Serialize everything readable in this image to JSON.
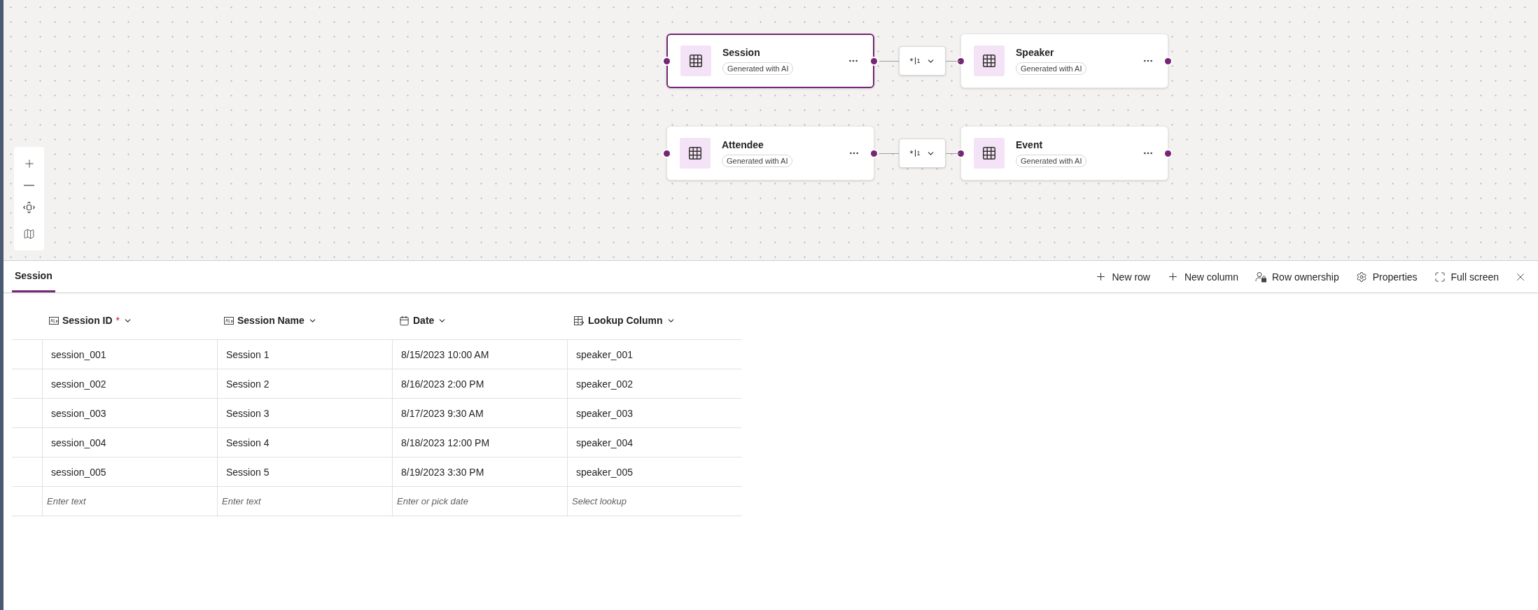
{
  "diagram_rows": [
    {
      "entities": [
        {
          "name": "Session",
          "badge": "Generated with AI",
          "selected": true
        },
        {
          "name": "Speaker",
          "badge": "Generated with AI",
          "selected": false
        }
      ],
      "relationship": {
        "many": "*",
        "one": "1"
      }
    },
    {
      "entities": [
        {
          "name": "Attendee",
          "badge": "Generated with AI",
          "selected": false
        },
        {
          "name": "Event",
          "badge": "Generated with AI",
          "selected": false
        }
      ],
      "relationship": {
        "many": "*",
        "one": "1"
      }
    }
  ],
  "tabs": [
    {
      "label": "Session",
      "selected": true
    }
  ],
  "toolbar": [
    {
      "kind": "add",
      "label": "New row"
    },
    {
      "kind": "add",
      "label": "New column"
    },
    {
      "kind": "ownership",
      "label": "Row ownership"
    },
    {
      "kind": "settings",
      "label": "Properties"
    },
    {
      "kind": "fullscreen",
      "label": "Full screen"
    }
  ],
  "table": {
    "columns": [
      {
        "kind": "text",
        "label": "Session ID",
        "required_mark": "*"
      },
      {
        "kind": "text",
        "label": "Session Name"
      },
      {
        "kind": "date",
        "label": "Date"
      },
      {
        "kind": "lookup",
        "label": "Lookup Column"
      }
    ],
    "rows": [
      [
        "session_001",
        "Session 1",
        "8/15/2023 10:00 AM",
        "speaker_001"
      ],
      [
        "session_002",
        "Session 2",
        "8/16/2023 2:00 PM",
        "speaker_002"
      ],
      [
        "session_003",
        "Session 3",
        "8/17/2023 9:30 AM",
        "speaker_003"
      ],
      [
        "session_004",
        "Session 4",
        "8/18/2023 12:00 PM",
        "speaker_004"
      ],
      [
        "session_005",
        "Session 5",
        "8/19/2023 3:30 PM",
        "speaker_005"
      ]
    ],
    "new_row": [
      {
        "placeholder": "Enter text"
      },
      {
        "placeholder": "Enter text"
      },
      {
        "placeholder": "Enter or pick date"
      },
      {
        "placeholder": "Select lookup"
      }
    ]
  }
}
